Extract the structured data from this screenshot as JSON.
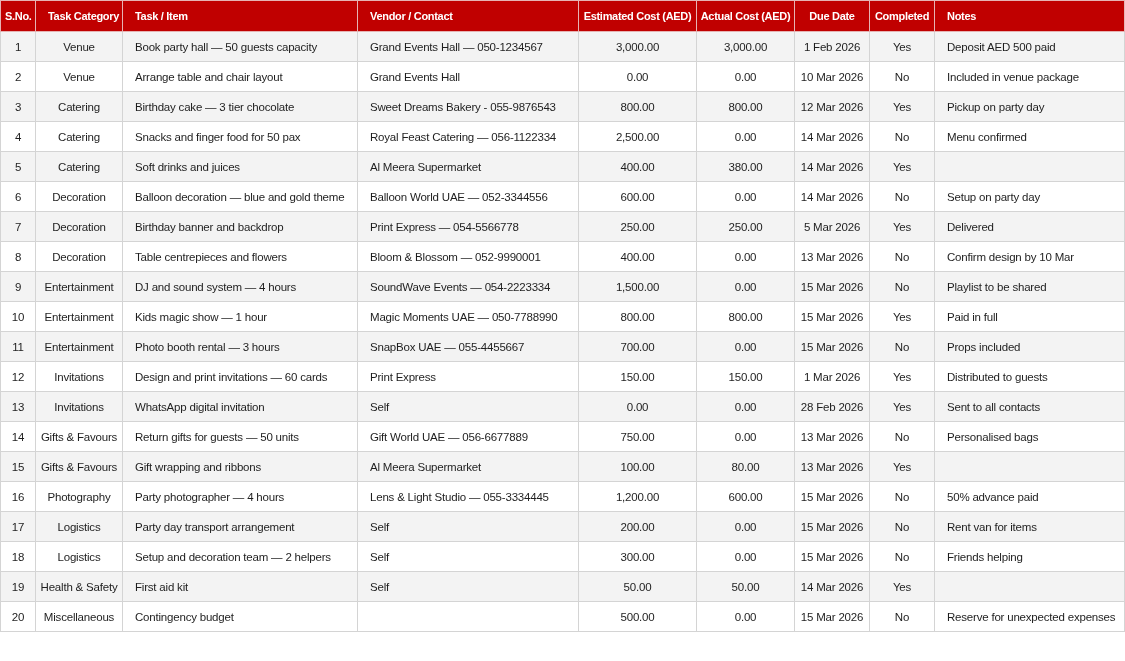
{
  "table": {
    "columns": [
      "S.No.",
      "Task Category",
      "Task / Item",
      "Vendor / Contact",
      "Estimated Cost (AED)",
      "Actual Cost (AED)",
      "Due Date",
      "Completed",
      "Notes"
    ],
    "rows": [
      {
        "sno": "1",
        "category": "Venue",
        "task": "Book party hall — 50 guests capacity",
        "vendor": "Grand Events Hall — 050-1234567",
        "estimated": "3,000.00",
        "actual": "3,000.00",
        "due": "1 Feb 2026",
        "completed": "Yes",
        "notes": "Deposit AED 500 paid"
      },
      {
        "sno": "2",
        "category": "Venue",
        "task": "Arrange table and chair layout",
        "vendor": "Grand Events Hall",
        "estimated": "0.00",
        "actual": "0.00",
        "due": "10 Mar 2026",
        "completed": "No",
        "notes": "Included in venue package"
      },
      {
        "sno": "3",
        "category": "Catering",
        "task": "Birthday cake — 3 tier chocolate",
        "vendor": "Sweet Dreams Bakery - 055-9876543",
        "estimated": "800.00",
        "actual": "800.00",
        "due": "12 Mar 2026",
        "completed": "Yes",
        "notes": "Pickup on party day"
      },
      {
        "sno": "4",
        "category": "Catering",
        "task": "Snacks and finger food for 50 pax",
        "vendor": "Royal Feast Catering — 056-1122334",
        "estimated": "2,500.00",
        "actual": "0.00",
        "due": "14 Mar 2026",
        "completed": "No",
        "notes": "Menu confirmed"
      },
      {
        "sno": "5",
        "category": "Catering",
        "task": "Soft drinks and juices",
        "vendor": "Al Meera Supermarket",
        "estimated": "400.00",
        "actual": "380.00",
        "due": "14 Mar 2026",
        "completed": "Yes"
      },
      {
        "sno": "6",
        "category": "Decoration",
        "task": "Balloon decoration — blue and gold theme",
        "vendor": "Balloon World UAE — 052-3344556",
        "estimated": "600.00",
        "actual": "0.00",
        "due": "14 Mar 2026",
        "completed": "No",
        "notes": "Setup on party day"
      },
      {
        "sno": "7",
        "category": "Decoration",
        "task": "Birthday banner and backdrop",
        "vendor": "Print Express — 054-5566778",
        "estimated": "250.00",
        "actual": "250.00",
        "due": "5 Mar 2026",
        "completed": "Yes",
        "notes": "Delivered"
      },
      {
        "sno": "8",
        "category": "Decoration",
        "task": "Table centrepieces and flowers",
        "vendor": "Bloom & Blossom — 052-9990001",
        "estimated": "400.00",
        "actual": "0.00",
        "due": "13 Mar 2026",
        "completed": "No",
        "notes": "Confirm design by 10 Mar"
      },
      {
        "sno": "9",
        "category": "Entertainment",
        "task": "DJ and sound system — 4 hours",
        "vendor": "SoundWave Events — 054-2223334",
        "estimated": "1,500.00",
        "actual": "0.00",
        "due": "15 Mar 2026",
        "completed": "No",
        "notes": "Playlist to be shared"
      },
      {
        "sno": "10",
        "category": "Entertainment",
        "task": "Kids magic show — 1 hour",
        "vendor": "Magic Moments UAE — 050-7788990",
        "estimated": "800.00",
        "actual": "800.00",
        "due": "15 Mar 2026",
        "completed": "Yes",
        "notes": "Paid in full"
      },
      {
        "sno": "11",
        "category": "Entertainment",
        "task": "Photo booth rental — 3 hours",
        "vendor": "SnapBox UAE — 055-4455667",
        "estimated": "700.00",
        "actual": "0.00",
        "due": "15 Mar 2026",
        "completed": "No",
        "notes": "Props included"
      },
      {
        "sno": "12",
        "category": "Invitations",
        "task": "Design and print invitations — 60 cards",
        "vendor": "Print Express",
        "estimated": "150.00",
        "actual": "150.00",
        "due": "1 Mar 2026",
        "completed": "Yes",
        "notes": "Distributed to guests"
      },
      {
        "sno": "13",
        "category": "Invitations",
        "task": "WhatsApp digital invitation",
        "vendor": "Self",
        "estimated": "0.00",
        "actual": "0.00",
        "due": "28 Feb 2026",
        "completed": "Yes",
        "notes": "Sent to all contacts"
      },
      {
        "sno": "14",
        "category": "Gifts & Favours",
        "task": "Return gifts for guests — 50 units",
        "vendor": "Gift World UAE — 056-6677889",
        "estimated": "750.00",
        "actual": "0.00",
        "due": "13 Mar 2026",
        "completed": "No",
        "notes": "Personalised bags"
      },
      {
        "sno": "15",
        "category": "Gifts & Favours",
        "task": "Gift wrapping and ribbons",
        "vendor": "Al Meera Supermarket",
        "estimated": "100.00",
        "actual": "80.00",
        "due": "13 Mar 2026",
        "completed": "Yes"
      },
      {
        "sno": "16",
        "category": "Photography",
        "task": "Party photographer — 4 hours",
        "vendor": "Lens & Light Studio — 055-3334445",
        "estimated": "1,200.00",
        "actual": "600.00",
        "due": "15 Mar 2026",
        "completed": "No",
        "notes": "50% advance paid"
      },
      {
        "sno": "17",
        "category": "Logistics",
        "task": "Party day transport arrangement",
        "vendor": "Self",
        "estimated": "200.00",
        "actual": "0.00",
        "due": "15 Mar 2026",
        "completed": "No",
        "notes": "Rent van for items"
      },
      {
        "sno": "18",
        "category": "Logistics",
        "task": "Setup and decoration team — 2 helpers",
        "vendor": "Self",
        "estimated": "300.00",
        "actual": "0.00",
        "due": "15 Mar 2026",
        "completed": "No",
        "notes": "Friends helping"
      },
      {
        "sno": "19",
        "category": "Health & Safety",
        "task": "First aid kit",
        "vendor": "Self",
        "estimated": "50.00",
        "actual": "50.00",
        "due": "14 Mar 2026",
        "completed": "Yes"
      },
      {
        "sno": "20",
        "category": "Miscellaneous",
        "task": "Contingency budget",
        "estimated": "500.00",
        "actual": "0.00",
        "due": "15 Mar 2026",
        "completed": "No",
        "notes": "Reserve for unexpected expenses"
      }
    ]
  }
}
